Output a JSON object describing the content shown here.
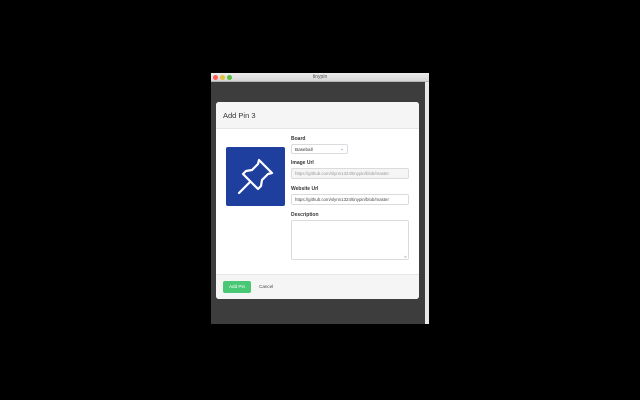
{
  "window": {
    "title": "tinypin"
  },
  "modal": {
    "title": "Add Pin 3",
    "board": {
      "label": "Board",
      "value": "Baseball"
    },
    "image_url": {
      "label": "Image Url",
      "value": "https://github.com/slynn1324/tinypin/blob/master"
    },
    "website_url": {
      "label": "Website Url",
      "value": "https://github.com/slynn1324/tinypin/blob/master"
    },
    "description": {
      "label": "Description",
      "value": ""
    },
    "add_button": "Add Pin",
    "cancel_button": "Cancel"
  },
  "colors": {
    "preview_bg": "#1f3f9f",
    "add_button_bg": "#48c774"
  },
  "icons": {
    "preview": "pushpin-icon",
    "select": "chevron-down-icon"
  }
}
